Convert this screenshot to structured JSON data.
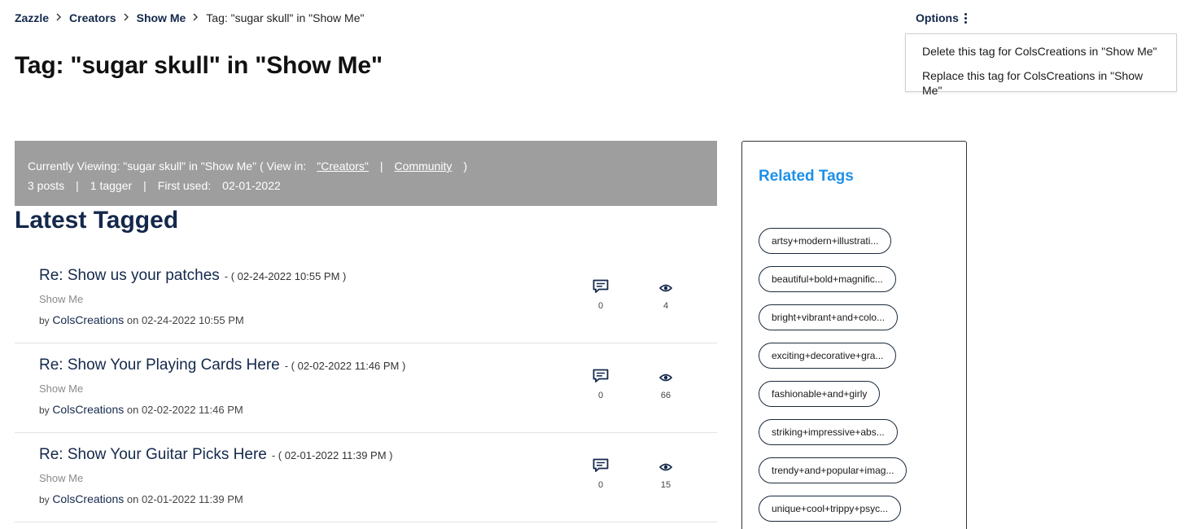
{
  "breadcrumb": {
    "items": [
      "Zazzle",
      "Creators",
      "Show Me"
    ],
    "current": "Tag: \"sugar skull\" in \"Show Me\""
  },
  "options": {
    "label": "Options",
    "menu": [
      "Delete this tag for ColsCreations in \"Show Me\"",
      "Replace this tag for ColsCreations in \"Show Me\""
    ]
  },
  "page_title": "Tag: \"sugar skull\" in \"Show Me\"",
  "info": {
    "currently_viewing": "Currently Viewing: \"sugar skull\" in \"Show Me\" ( View in:",
    "link_creators": "\"Creators\"",
    "sep": "|",
    "link_community": "Community",
    "close": ")",
    "posts": "3 posts",
    "taggers": "1 tagger",
    "first_used_label": "First used:",
    "first_used_date": "02-01-2022"
  },
  "latest_heading": "Latest Tagged",
  "posts": [
    {
      "title": "Re: Show us your patches",
      "date": "- ( 02-24-2022 10:55 PM )",
      "board": "Show Me",
      "by": "by",
      "author": "ColsCreations",
      "on": "on 02-24-2022 10:55 PM",
      "replies": "0",
      "views": "4"
    },
    {
      "title": "Re: Show Your Playing Cards Here",
      "date": "- ( 02-02-2022 11:46 PM )",
      "board": "Show Me",
      "by": "by",
      "author": "ColsCreations",
      "on": "on 02-02-2022 11:46 PM",
      "replies": "0",
      "views": "66"
    },
    {
      "title": "Re: Show Your Guitar Picks Here",
      "date": "- ( 02-01-2022 11:39 PM )",
      "board": "Show Me",
      "by": "by",
      "author": "ColsCreations",
      "on": "on 02-01-2022 11:39 PM",
      "replies": "0",
      "views": "15"
    }
  ],
  "related": {
    "title": "Related Tags",
    "tags": [
      "artsy+modern+illustrati...",
      "beautiful+bold+magnific...",
      "bright+vibrant+and+colo...",
      "exciting+decorative+gra...",
      "fashionable+and+girly",
      "striking+impressive+abs...",
      "trendy+and+popular+imag...",
      "unique+cool+trippy+psyc..."
    ]
  },
  "icons": {
    "separator": "chevron-right-icon",
    "options": "kebab-menu-icon",
    "replies": "comment-icon",
    "views": "eye-icon"
  },
  "colors": {
    "navy": "#14284b",
    "info_bg": "#9e9e9e",
    "related_title": "#1e90e8"
  }
}
